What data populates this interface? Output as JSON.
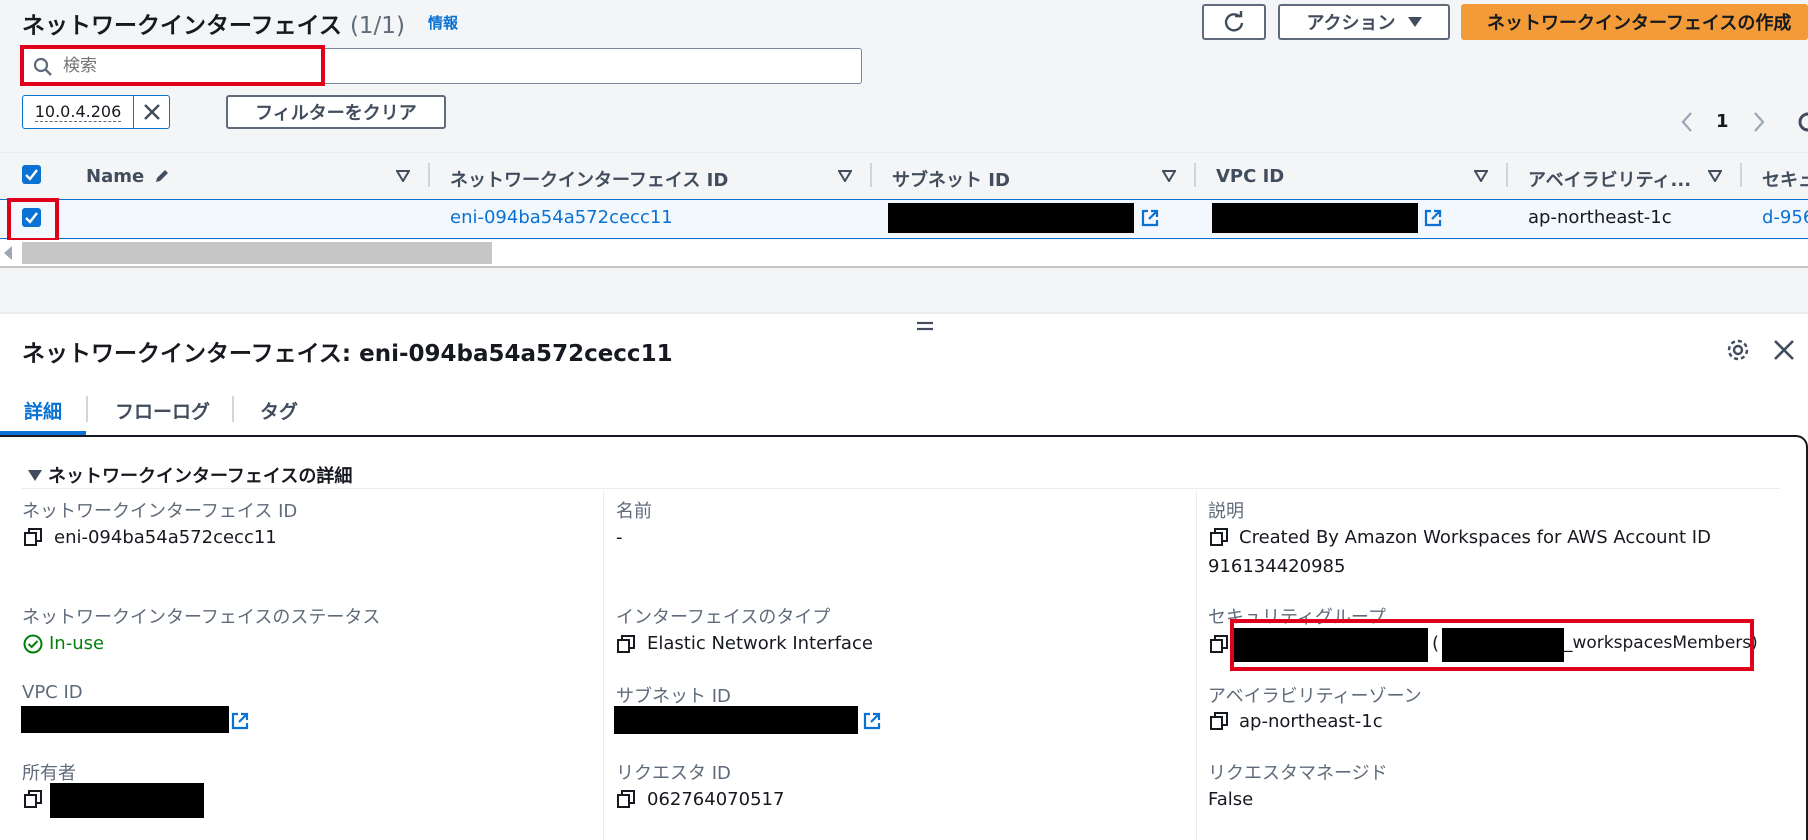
{
  "header": {
    "title": "ネットワークインターフェイス",
    "count": "(1/1)",
    "info_link": "情報",
    "actions_label": "アクション",
    "create_label": "ネットワークインターフェイスの作成"
  },
  "search": {
    "placeholder": "検索"
  },
  "filter": {
    "token": "10.0.4.206",
    "clear_label": "フィルターをクリア"
  },
  "pagination": {
    "page": "1"
  },
  "table": {
    "columns": [
      "Name",
      "ネットワークインターフェイス ID",
      "サブネット ID",
      "VPC ID",
      "アベイラビリティ...",
      "セキュ"
    ],
    "rows": [
      {
        "name": "",
        "eni_id": "eni-094ba54a572cecc11",
        "az": "ap-northeast-1c",
        "sg_partial": "d-956"
      }
    ]
  },
  "detail": {
    "title": "ネットワークインターフェイス: eni-094ba54a572cecc11",
    "tabs": [
      "詳細",
      "フローログ",
      "タグ"
    ],
    "section_title": "ネットワークインターフェイスの詳細",
    "fields": {
      "eni_id_label": "ネットワークインターフェイス ID",
      "eni_id_value": "eni-094ba54a572cecc11",
      "name_label": "名前",
      "name_value": "-",
      "desc_label": "説明",
      "desc_value_line1": "Created By Amazon Workspaces for AWS Account ID",
      "desc_value_line2": "916134420985",
      "status_label": "ネットワークインターフェイスのステータス",
      "status_value": "In-use",
      "type_label": "インターフェイスのタイプ",
      "type_value": "Elastic Network Interface",
      "sg_label": "セキュリティグループ",
      "sg_suffix": "_workspacesMembers)",
      "sg_open_paren": "(",
      "vpc_label": "VPC ID",
      "subnet_label": "サブネット ID",
      "az_label": "アベイラビリティーゾーン",
      "az_value": "ap-northeast-1c",
      "owner_label": "所有者",
      "requester_label": "リクエスタ ID",
      "requester_value": "062764070517",
      "req_managed_label": "リクエスタマネージド",
      "req_managed_value": "False"
    }
  },
  "colors": {
    "accent": "#0972d3",
    "primary_button": "#f29b38",
    "highlight": "#e0001b",
    "success": "#037f0c"
  }
}
